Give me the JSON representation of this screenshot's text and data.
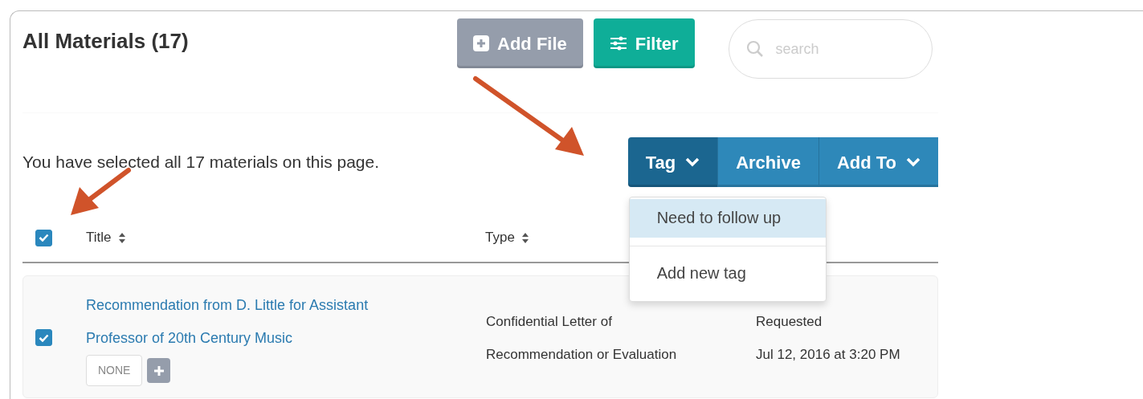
{
  "page": {
    "title": "All Materials (17)"
  },
  "toolbar": {
    "buttons": [
      {
        "label": "Add File",
        "kind": "add"
      },
      {
        "label": "Filter",
        "kind": "filter"
      }
    ],
    "search": {
      "placeholder": "search"
    }
  },
  "selection_message": "You have selected all 17 materials on this page.",
  "bulk_actions": [
    {
      "label": "Tag",
      "dropdown": true,
      "selected": true
    },
    {
      "label": "Archive",
      "dropdown": false,
      "selected": false
    },
    {
      "label": "Add To",
      "dropdown": true,
      "selected": false
    }
  ],
  "tag_menu": {
    "items": [
      {
        "label": "Need to follow up",
        "selected": true
      }
    ],
    "action": "Add new tag"
  },
  "table": {
    "select_all_checked": true,
    "columns": [
      {
        "label": "Title",
        "sortable": true
      },
      {
        "label": "Type",
        "sortable": true
      }
    ],
    "rows": [
      {
        "checked": true,
        "title": "Recommendation from D. Little for Assistant Professor of 20th Century Music",
        "tags": [
          "NONE"
        ],
        "type": "Confidential Letter of Recommendation or Evaluation",
        "status": "Requested",
        "date": "Jul 12, 2016 at 3:20 PM"
      }
    ]
  }
}
